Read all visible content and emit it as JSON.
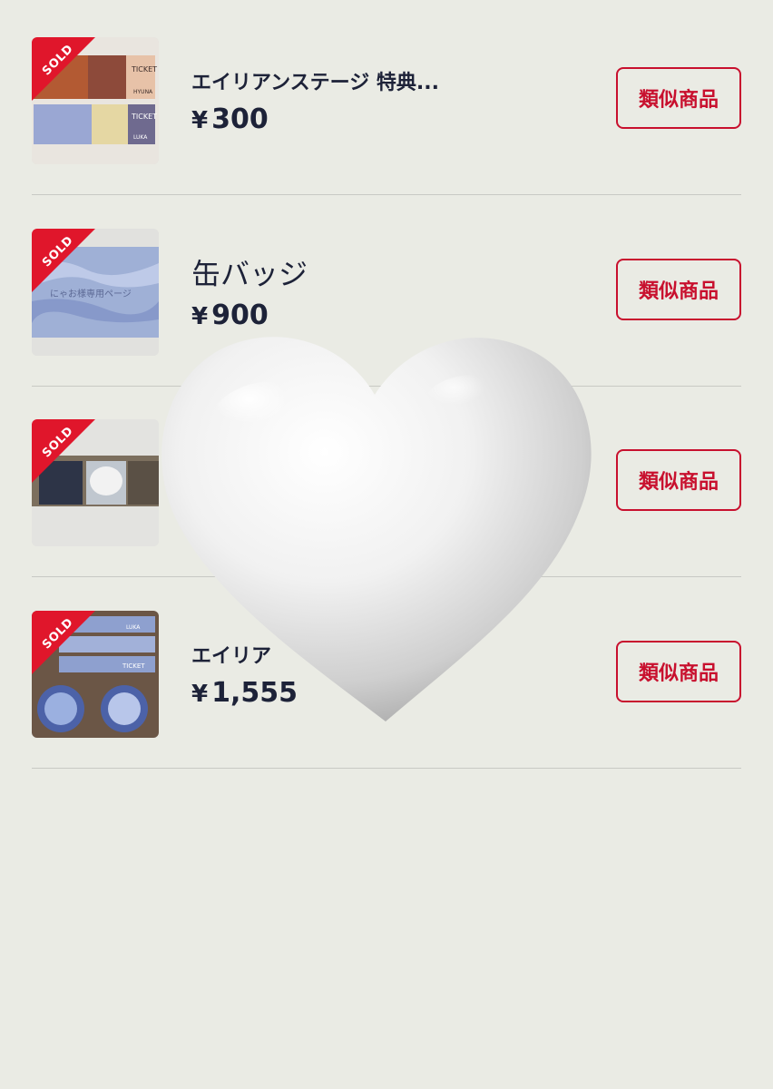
{
  "items": [
    {
      "sold_label": "SOLD",
      "title": "エイリアンステージ 特典...",
      "price_symbol": "¥",
      "price": "300",
      "button_label": "類似商品",
      "thumb_texts": [
        "TICKET",
        "HYUNA",
        "TICKET",
        "LUKA"
      ]
    },
    {
      "sold_label": "SOLD",
      "title": "缶バッジ",
      "price_symbol": "¥",
      "price": "900",
      "button_label": "類似商品",
      "thumb_texts": [
        "にゃお様専用ページ"
      ]
    },
    {
      "sold_label": "SOLD",
      "title": "",
      "price_symbol": "",
      "price": "",
      "button_label": "類似商品",
      "thumb_texts": []
    },
    {
      "sold_label": "SOLD",
      "title": "エイリア",
      "price_symbol": "¥",
      "price": "1,555",
      "button_label": "類似商品",
      "thumb_texts": [
        "TICKET",
        "LUKA"
      ]
    }
  ],
  "colors": {
    "background": "#eaebe4",
    "accent": "#c8102e",
    "badge": "#e0162b",
    "text": "#1d2238"
  },
  "overlay": {
    "icon": "heart-icon"
  }
}
